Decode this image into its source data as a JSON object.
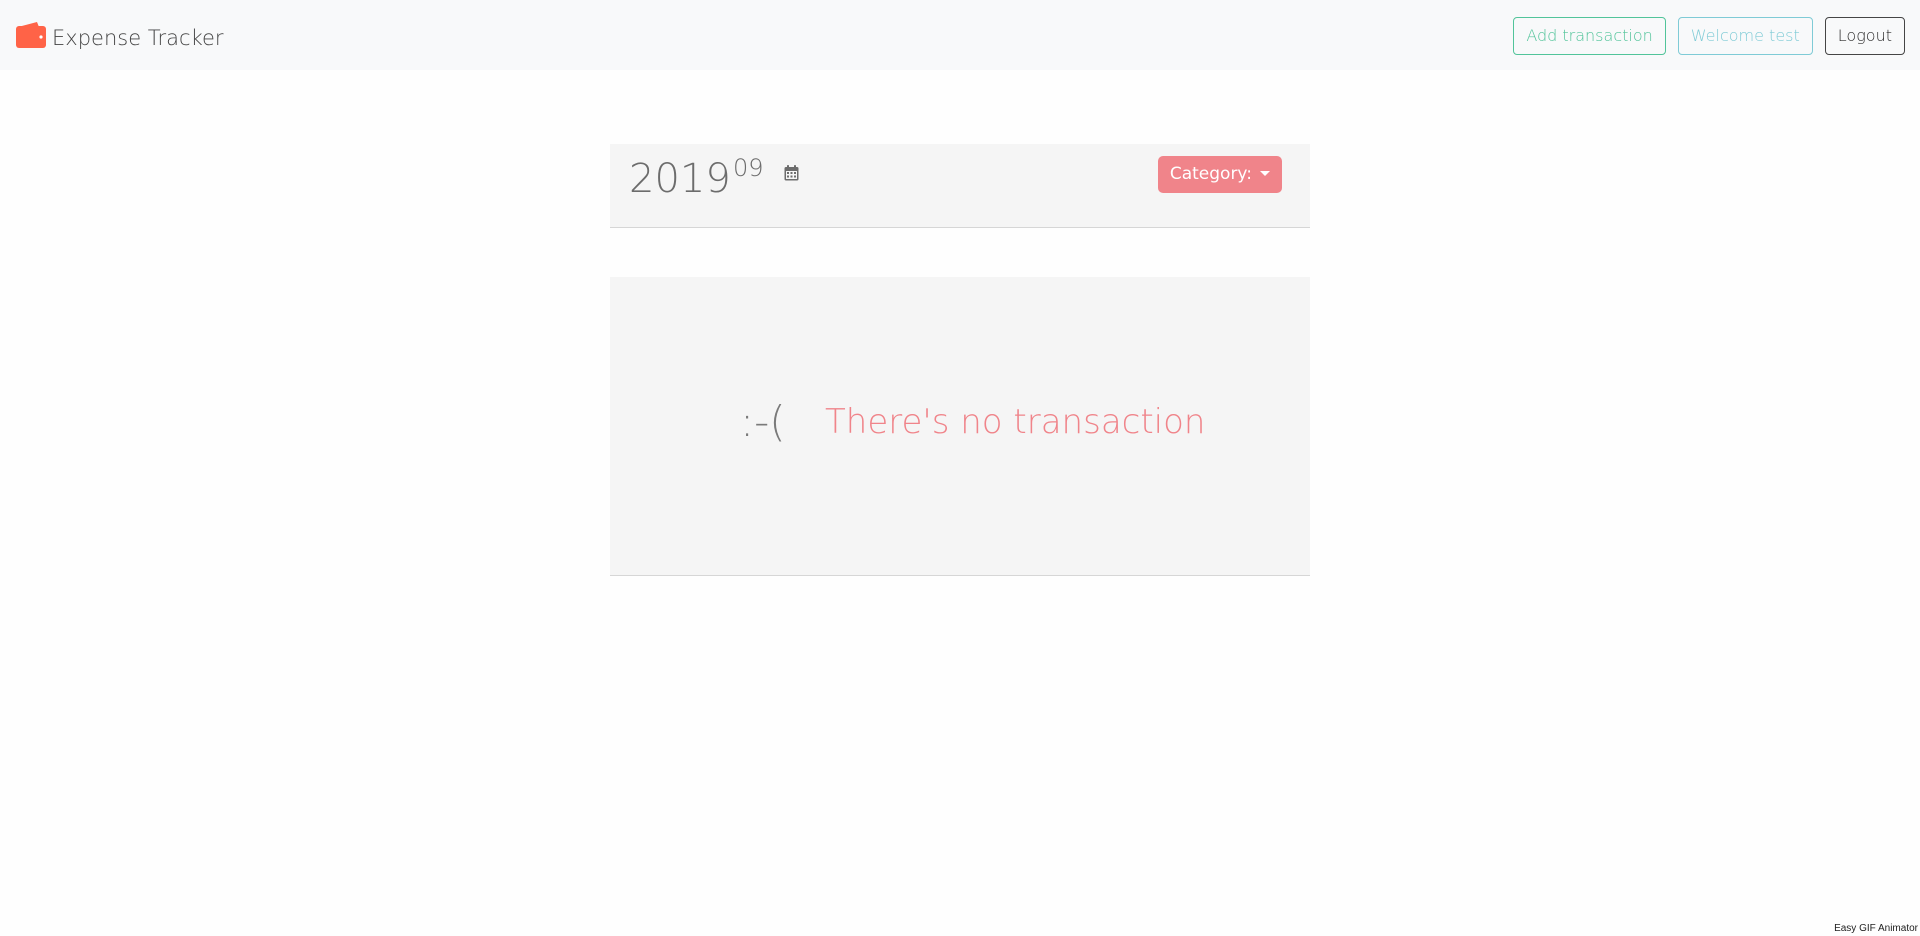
{
  "header": {
    "brand": "Expense Tracker",
    "brand_icon": "wallet-icon",
    "add_transaction_label": "Add transaction",
    "welcome_label": "Welcome test",
    "logout_label": "Logout"
  },
  "period": {
    "year": "2019",
    "month": "09",
    "calendar_icon": "calendar-icon",
    "category_label": "Category:"
  },
  "empty_state": {
    "face": ":-(",
    "message": "There's no transaction"
  },
  "watermark": "Easy GIF Animator",
  "colors": {
    "accent": "#f0848a",
    "brand_icon": "#ff6347",
    "add_border": "#52c49a",
    "welcome_border": "#7fcbd6"
  }
}
